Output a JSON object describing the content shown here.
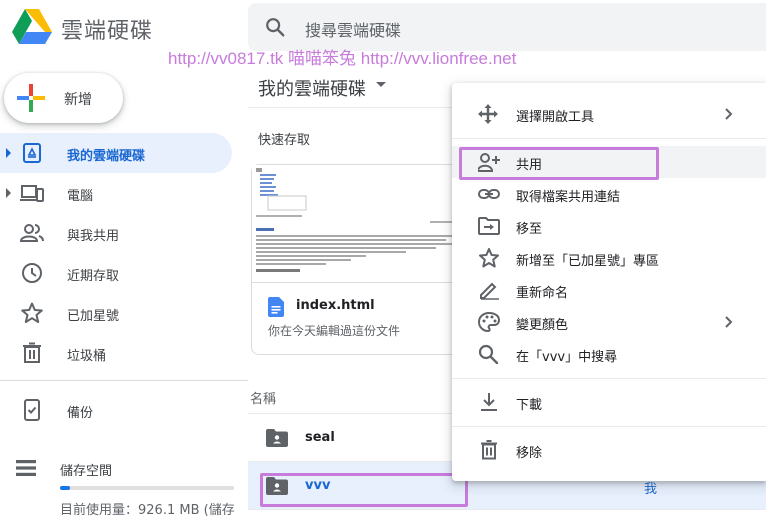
{
  "header": {
    "app_title": "雲端硬碟",
    "search_placeholder": "搜尋雲端硬碟",
    "watermark": "http://vv0817.tk 喵喵笨兔 http://vvv.lionfree.net"
  },
  "new_button": {
    "label": "新增"
  },
  "sidebar": {
    "items": [
      {
        "label": "我的雲端硬碟",
        "icon": "my-drive-icon",
        "active": true
      },
      {
        "label": "電腦",
        "icon": "computers-icon"
      },
      {
        "label": "與我共用",
        "icon": "shared-with-me-icon"
      },
      {
        "label": "近期存取",
        "icon": "recent-icon"
      },
      {
        "label": "已加星號",
        "icon": "star-icon"
      },
      {
        "label": "垃圾桶",
        "icon": "trash-icon"
      },
      {
        "label": "備份",
        "icon": "backup-icon"
      },
      {
        "label": "儲存空間",
        "icon": "storage-icon"
      }
    ],
    "storage_usage": "目前使用量：926.1 MB (儲存",
    "storage_used_fraction": 0.06
  },
  "main": {
    "title": "我的雲端硬碟",
    "quick_access_label": "快速存取",
    "quick_access_card": {
      "file_name": "index.html",
      "activity": "你在今天編輯過這份文件"
    },
    "list_header": "名稱",
    "rows": [
      {
        "name": "seal",
        "owner": ""
      },
      {
        "name": "vvv",
        "owner": "我",
        "selected": true
      }
    ]
  },
  "context_menu": {
    "items": [
      {
        "label": "選擇開啟工具",
        "icon": "open-with-icon",
        "has_submenu": true
      },
      {
        "label": "共用",
        "icon": "share-icon",
        "highlighted": true
      },
      {
        "label": "取得檔案共用連結",
        "icon": "link-icon"
      },
      {
        "label": "移至",
        "icon": "move-to-icon"
      },
      {
        "label": "新增至「已加星號」專區",
        "icon": "star-icon"
      },
      {
        "label": "重新命名",
        "icon": "rename-icon"
      },
      {
        "label": "變更顏色",
        "icon": "palette-icon",
        "has_submenu": true
      },
      {
        "label": "在「vvv」中搜尋",
        "icon": "search-icon"
      },
      {
        "label": "下載",
        "icon": "download-icon"
      },
      {
        "label": "移除",
        "icon": "trash-icon"
      }
    ]
  },
  "colors": {
    "accent": "#1967d2",
    "highlight": "#c77bdb",
    "selected_bg": "#e8f0fe"
  }
}
